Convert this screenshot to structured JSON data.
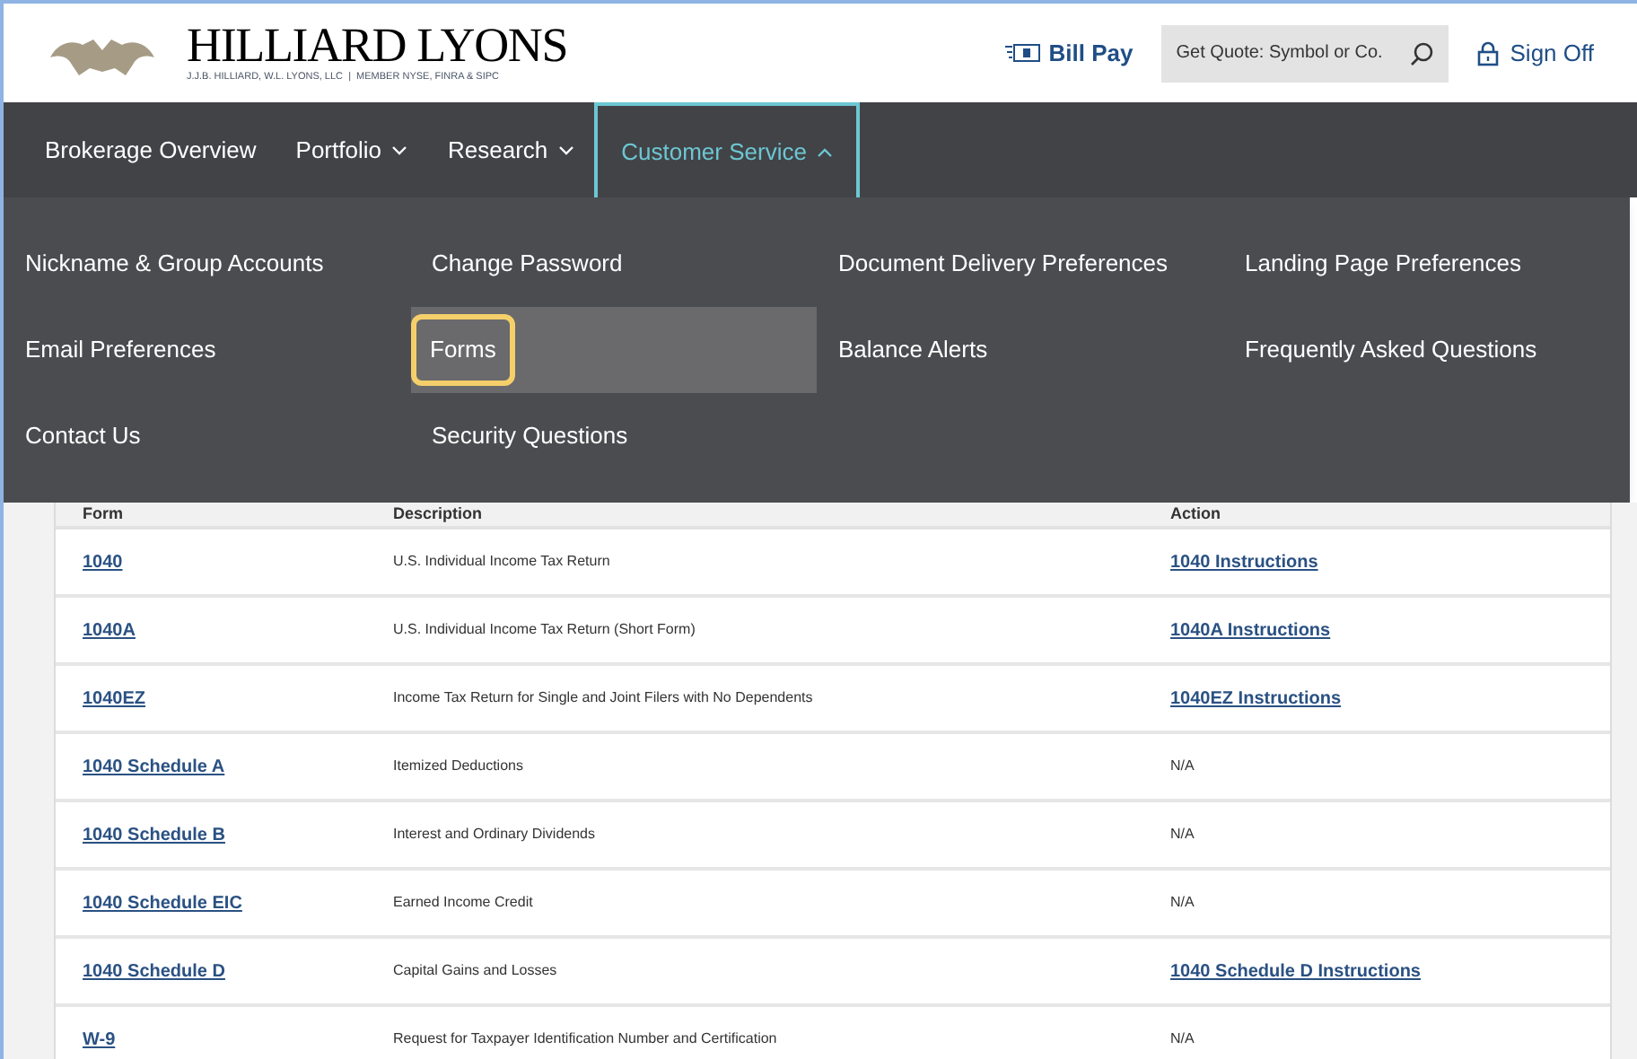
{
  "header": {
    "brand": "HILLIARD LYONS",
    "tagline": "J.J.B. HILLIARD, W.L. LYONS, LLC  |  MEMBER NYSE, FINRA & SIPC",
    "bill_pay": "Bill Pay",
    "quote_search": {
      "placeholder": "Get Quote: Symbol or Co."
    },
    "sign_off": "Sign Off"
  },
  "nav": [
    {
      "label": "Brokerage Overview",
      "kind": "link",
      "selected": false
    },
    {
      "label": "Portfolio",
      "kind": "menu",
      "expanded": false,
      "selected": false
    },
    {
      "label": "Research",
      "kind": "menu",
      "expanded": false,
      "selected": false
    },
    {
      "label": "Customer Service",
      "kind": "menu",
      "expanded": true,
      "selected": true
    }
  ],
  "dropdown": {
    "columns": [
      [
        {
          "label": "Nickname & Group Accounts",
          "selected": false
        },
        {
          "label": "Email Preferences",
          "selected": false
        },
        {
          "label": "Contact Us",
          "selected": false
        }
      ],
      [
        {
          "label": "Change Password",
          "selected": false
        },
        {
          "label": "Forms",
          "selected": true
        },
        {
          "label": "Security Questions",
          "selected": false
        }
      ],
      [
        {
          "label": "Document Delivery Preferences",
          "selected": false
        },
        {
          "label": "Balance Alerts",
          "selected": false
        }
      ],
      [
        {
          "label": "Landing Page Preferences",
          "selected": false
        },
        {
          "label": "Frequently Asked Questions",
          "selected": false
        }
      ]
    ]
  },
  "table": {
    "columns": [
      "Form",
      "Description",
      "Action"
    ],
    "rows": [
      {
        "form": "1040",
        "description": "U.S. Individual Income Tax Return",
        "action": "1040 Instructions",
        "kind": "link"
      },
      {
        "form": "1040A",
        "description": "U.S. Individual Income Tax Return (Short Form)",
        "action": "1040A Instructions",
        "kind": "link"
      },
      {
        "form": "1040EZ",
        "description": "Income Tax Return for Single and Joint Filers with No Dependents",
        "action": "1040EZ Instructions",
        "kind": "link"
      },
      {
        "form": "1040 Schedule A",
        "description": "Itemized Deductions",
        "action": "N/A",
        "kind": "text"
      },
      {
        "form": "1040 Schedule B",
        "description": "Interest and Ordinary Dividends",
        "action": "N/A",
        "kind": "text"
      },
      {
        "form": "1040 Schedule EIC",
        "description": "Earned Income Credit",
        "action": "N/A",
        "kind": "text"
      },
      {
        "form": "1040 Schedule D",
        "description": "Capital Gains and Losses",
        "action": "1040 Schedule D Instructions",
        "kind": "link"
      },
      {
        "form": "W-9",
        "description": "Request for Taxpayer Identification Number and Certification",
        "action": "N/A",
        "kind": "text"
      }
    ]
  }
}
